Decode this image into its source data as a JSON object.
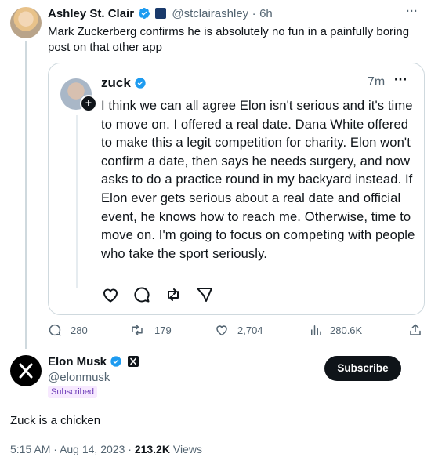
{
  "original_tweet": {
    "author_name": "Ashley St. Clair",
    "handle": "@stclairashley",
    "separator": "·",
    "time": "6h",
    "text": "Mark Zuckerberg confirms he is absolutely no fun in a painfully boring post on that other app",
    "more": "···"
  },
  "quoted_post": {
    "author_name": "zuck",
    "time": "7m",
    "more": "···",
    "text": "I think we can all agree Elon isn't serious and it's time to move on. I offered a real date. Dana White offered to make this a legit competition for charity. Elon won't confirm a date, then says he needs surgery, and now asks to do a practice round in my backyard instead. If Elon ever gets serious about a real date and official event, he knows how to reach me. Otherwise, time to move on. I'm going to focus on competing with people who take the sport seriously.",
    "avatar_badge": "+"
  },
  "stats": {
    "replies": "280",
    "reposts": "179",
    "likes": "2,704",
    "views": "280.6K"
  },
  "reply": {
    "author_name": "Elon Musk",
    "handle": "@elonmusk",
    "subscribed_label": "Subscribed",
    "subscribe_button": "Subscribe",
    "text": "Zuck is a chicken",
    "time": "5:15 AM",
    "dot": "·",
    "date": "Aug 14, 2023",
    "dot2": "·",
    "view_count": "213.2K",
    "views_label": "Views"
  },
  "colors": {
    "verified_blue": "#1d9bf0",
    "muted": "#536471",
    "border": "#cfd9de"
  }
}
